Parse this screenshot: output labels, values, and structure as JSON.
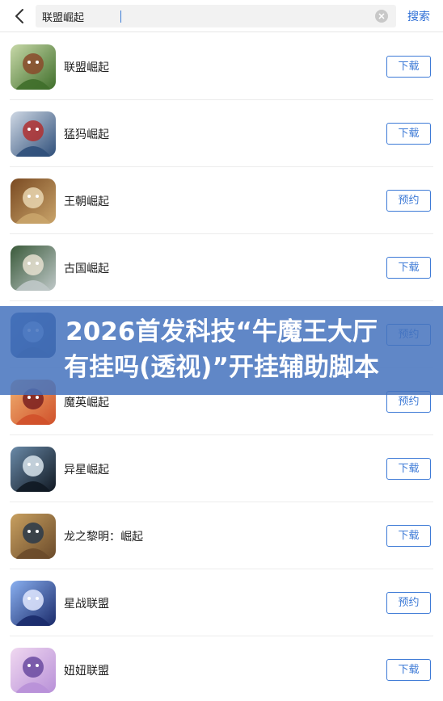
{
  "search": {
    "value": "联盟崛起",
    "button_label": "搜索"
  },
  "apps": [
    {
      "name": "联盟崛起",
      "action": "下载",
      "icon": "goblin-warrior-icon",
      "colors": [
        "#3f6e2a",
        "#c7d8a8",
        "#8a4a2a"
      ]
    },
    {
      "name": "猛犸崛起",
      "action": "下载",
      "icon": "mammoth-beast-icon",
      "colors": [
        "#2f4f7a",
        "#cfd8e4",
        "#b03030"
      ]
    },
    {
      "name": "王朝崛起",
      "action": "预约",
      "icon": "cavalry-rider-icon",
      "colors": [
        "#c9a46a",
        "#7a4a22",
        "#e9d6b0"
      ]
    },
    {
      "name": "古国崛起",
      "action": "下载",
      "icon": "ancient-general-icon",
      "colors": [
        "#bfc8c8",
        "#3a5a3a",
        "#e6e0d0"
      ]
    },
    {
      "name": "",
      "action": "预约",
      "icon": "battle-emblem-icon",
      "colors": [
        "#1e3a6a",
        "#3a5fa0",
        "#8fb0e0"
      ]
    },
    {
      "name": "魔英崛起",
      "action": "预约",
      "icon": "fire-heroine-icon",
      "colors": [
        "#d0502a",
        "#f0b070",
        "#7a2020"
      ]
    },
    {
      "name": "异星崛起",
      "action": "下载",
      "icon": "spaceship-icon",
      "colors": [
        "#101822",
        "#6a8aa8",
        "#d8e4ec"
      ]
    },
    {
      "name": "龙之黎明：崛起",
      "action": "下载",
      "icon": "shield-knight-icon",
      "colors": [
        "#6a4a2a",
        "#c8a060",
        "#2a3a4a"
      ]
    },
    {
      "name": "星战联盟",
      "action": "预约",
      "icon": "star-cruiser-icon",
      "colors": [
        "#1a2a6a",
        "#8ab0f0",
        "#e0e8ff"
      ]
    },
    {
      "name": "妞妞联盟",
      "action": "下载",
      "icon": "anime-girl-icon",
      "colors": [
        "#b890d8",
        "#f0d8f0",
        "#6a4aa0"
      ]
    }
  ],
  "overlay": {
    "line1": "2026首发科技“牛魔王大厅",
    "line2": "有挂吗(透视)”开挂辅助脚本"
  }
}
